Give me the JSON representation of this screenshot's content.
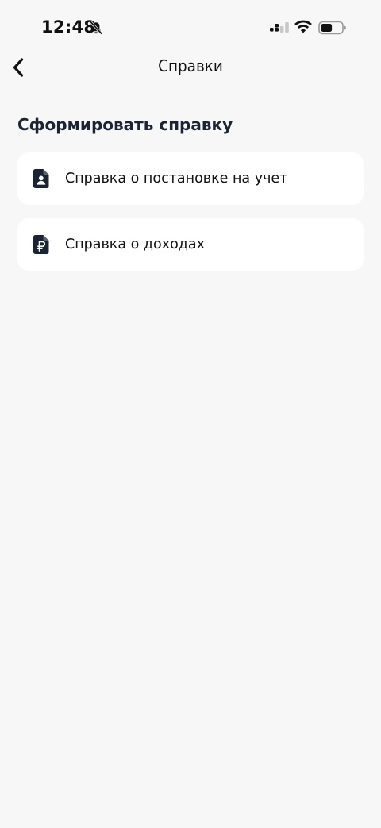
{
  "status_bar": {
    "time": "12:48",
    "icons": [
      "bell-off-icon",
      "cellular-signal-icon",
      "wifi-icon",
      "battery-icon"
    ]
  },
  "header": {
    "title": "Справки",
    "back_icon": "chevron-left-icon"
  },
  "section": {
    "title": "Сформировать справку",
    "items": [
      {
        "label": "Справка о постановке на учет",
        "icon": "document-person-icon"
      },
      {
        "label": "Справка о доходах",
        "icon": "document-ruble-icon"
      }
    ]
  },
  "colors": {
    "background": "#f7f7f7",
    "card": "#ffffff",
    "icon": "#1c2433",
    "text": "#111111"
  }
}
